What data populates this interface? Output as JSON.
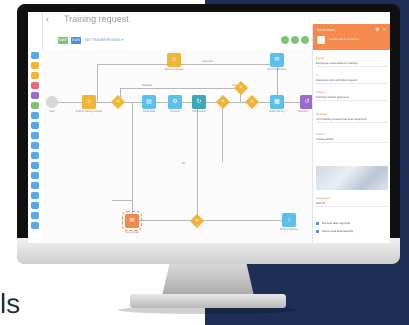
{
  "backdrop": {
    "partial_word": "ls",
    "navy": "#1e2f56"
  },
  "screen": {
    "title": "Training request",
    "back_glyph": "‹",
    "toolbar": {
      "buttons": [
        {
          "label": "SAVE",
          "color": "#7cc576"
        },
        {
          "label": "RUN",
          "color": "#4b8fd9"
        }
      ],
      "links": [
        "SETTINGS",
        "VERSIONS ▾"
      ]
    },
    "status_dots": [
      "#7cc576",
      "#7cc576",
      "#7cc576"
    ],
    "rail_colors": [
      "#5aa7e6",
      "#f0b537",
      "#f0b537",
      "#e7697b",
      "#9b6bc9",
      "#7cc576",
      "#5aa7e6",
      "#5aa7e6",
      "#5aa7e6",
      "#5aa7e6",
      "#5aa7e6",
      "#5aa7e6",
      "#5aa7e6",
      "#5aa7e6",
      "#5aa7e6",
      "#5aa7e6",
      "#5aa7e6",
      "#5aa7e6"
    ],
    "flow": {
      "lanes": [
        "Approved",
        "Rejected",
        "Yes",
        "No"
      ],
      "nodes": [
        {
          "label": "Start",
          "color": "#9a9a9a",
          "icon": "play-icon"
        },
        {
          "label": "Submit training request",
          "color": "#f0b537",
          "icon": "user-task-icon"
        },
        {
          "label": "Approve request",
          "color": "#f0b537",
          "icon": "approve-icon"
        },
        {
          "label": "Send notification",
          "color": "#5bc0eb",
          "icon": "message-icon"
        },
        {
          "label": "Read data",
          "color": "#5bc0eb",
          "icon": "data-icon"
        },
        {
          "label": "Process",
          "color": "#5bc0eb",
          "icon": "process-icon"
        },
        {
          "label": "Subprocess",
          "color": "#3fa6b8",
          "icon": "subprocess-icon"
        },
        {
          "label": "Book training",
          "color": "#5bc0eb",
          "icon": "calendar-icon"
        },
        {
          "label": "Register",
          "color": "#9b6bc9",
          "icon": "register-icon"
        },
        {
          "label": "Send email",
          "color": "#f08a4b",
          "icon": "email-icon"
        },
        {
          "label": "Notify employee",
          "color": "#5bc0eb",
          "icon": "bell-icon"
        }
      ]
    },
    "panel": {
      "header_title": "Send email",
      "header_sub": "Send email to employee",
      "fields": [
        {
          "label": "Sender",
          "value": "Employee responsible for training"
        },
        {
          "label": "To",
          "value": "Employee who submitted request"
        },
        {
          "label": "Subject",
          "value": "Training request approved"
        },
        {
          "label": "Message",
          "value": "Your training request has been approved"
        },
        {
          "label": "Activity",
          "value": "Create activity"
        },
        {
          "label": "Importance",
          "value": "Normal"
        }
      ],
      "checks": [
        "Execute after approval",
        "Send email automatically"
      ]
    }
  }
}
